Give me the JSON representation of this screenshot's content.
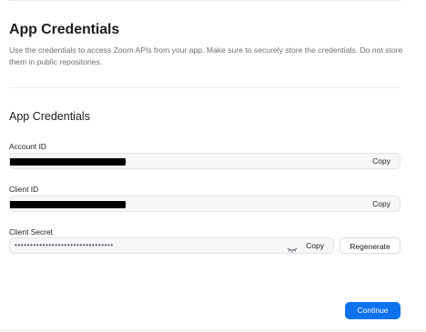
{
  "header": {
    "title": "App Credentials",
    "description": "Use the credentials to access Zoom APIs from your app. Make sure to securely store the credentials. Do not store them in public repositories."
  },
  "section": {
    "title": "App Credentials"
  },
  "fields": {
    "account_id": {
      "label": "Account ID",
      "copy_label": "Copy"
    },
    "client_id": {
      "label": "Client ID",
      "copy_label": "Copy"
    },
    "client_secret": {
      "label": "Client Secret",
      "masked_value": "••••••••••••••••••••••••••••••••",
      "toggle_icon": "eye-closed-icon",
      "copy_label": "Copy",
      "regenerate_label": "Regenerate"
    }
  },
  "footer": {
    "continue_label": "Continue"
  },
  "colors": {
    "primary": "#0e72ed",
    "field_background": "#f7f7f9",
    "muted_text": "#6e6e78"
  }
}
